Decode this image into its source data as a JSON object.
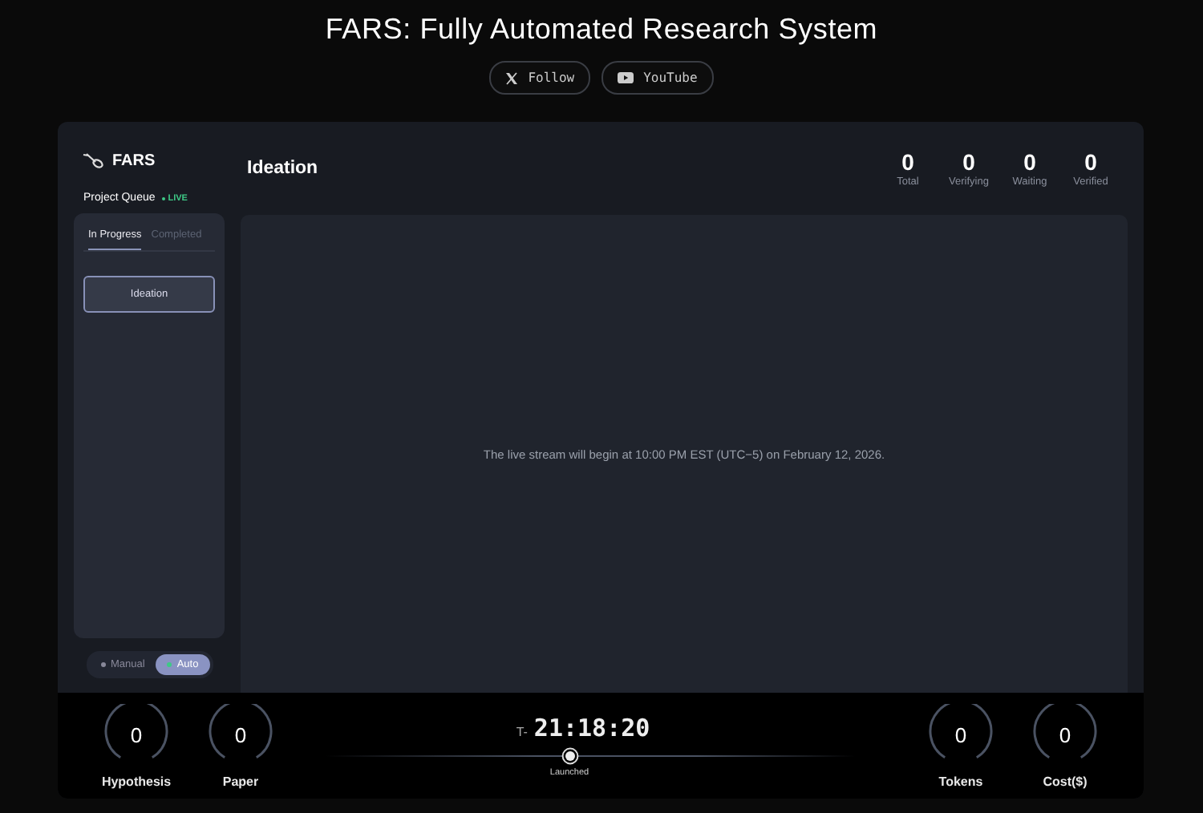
{
  "title": "FARS: Fully Automated Research System",
  "links": [
    {
      "kind": "x",
      "label": "Follow"
    },
    {
      "kind": "youtube",
      "label": "YouTube"
    }
  ],
  "sidebar": {
    "brand": "FARS",
    "queue_label": "Project Queue",
    "live_badge": "LIVE",
    "tabs": [
      {
        "label": "In Progress",
        "selected": true
      },
      {
        "label": "Completed",
        "selected": false
      }
    ],
    "items": [
      {
        "label": "Ideation",
        "selected": true
      }
    ],
    "modes": [
      {
        "label": "Manual",
        "selected": false
      },
      {
        "label": "Auto",
        "selected": true
      }
    ]
  },
  "main": {
    "heading": "Ideation",
    "stats": [
      {
        "value": "0",
        "label": "Total"
      },
      {
        "value": "0",
        "label": "Verifying"
      },
      {
        "value": "0",
        "label": "Waiting"
      },
      {
        "value": "0",
        "label": "Verified"
      }
    ],
    "message": "The live stream will begin at 10:00 PM EST (UTC−5) on February 12, 2026."
  },
  "footer": {
    "left_dials": [
      {
        "value": "0",
        "label": "Hypothesis"
      },
      {
        "value": "0",
        "label": "Paper"
      }
    ],
    "countdown_prefix": "T-",
    "countdown": "21:18:20",
    "milestone": "Launched",
    "right_dials": [
      {
        "value": "0",
        "label": "Tokens"
      },
      {
        "value": "0",
        "label": "Cost($)"
      }
    ]
  }
}
